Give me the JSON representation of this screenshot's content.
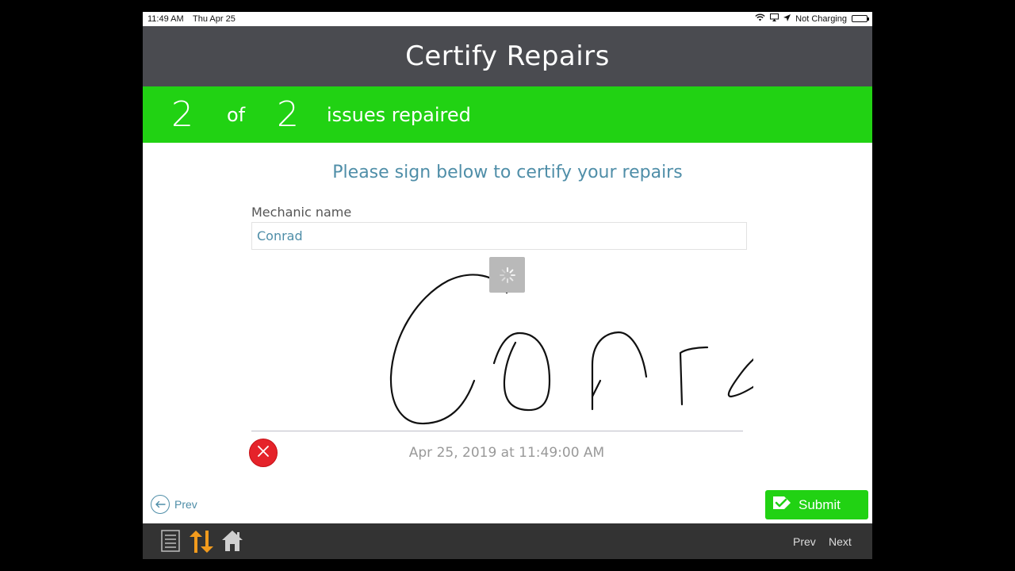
{
  "status_bar": {
    "time": "11:49 AM",
    "date": "Thu Apr 25",
    "charging_status": "Not Charging"
  },
  "header": {
    "title": "Certify Repairs"
  },
  "progress": {
    "repaired": "2",
    "of_label": "of",
    "total": "2",
    "suffix": "issues repaired"
  },
  "form": {
    "instructions": "Please sign below to certify your repairs",
    "mechanic_label": "Mechanic name",
    "mechanic_value": "Conrad",
    "timestamp": "Apr 25, 2019 at 11:49:00 AM"
  },
  "navigation": {
    "prev_label": "Prev",
    "submit_label": "Submit"
  },
  "toolbar": {
    "prev_label": "Prev",
    "next_label": "Next"
  },
  "icons": {
    "wifi": "wifi-icon",
    "screen_mirror": "screen-mirror-icon",
    "location": "location-icon",
    "battery": "battery-icon",
    "spinner": "spinner-icon",
    "clear": "close-icon",
    "prev": "arrow-left-icon",
    "submit": "checkmark-icon",
    "list": "list-icon",
    "sort": "sort-arrows-icon",
    "home": "home-icon"
  },
  "colors": {
    "header_bg": "#4a4b50",
    "banner_green": "#21d213",
    "accent_blue": "#4f8ea8",
    "clear_red": "#e5232a",
    "toolbar_bg": "#333333",
    "toolbar_orange": "#f29b1d"
  }
}
